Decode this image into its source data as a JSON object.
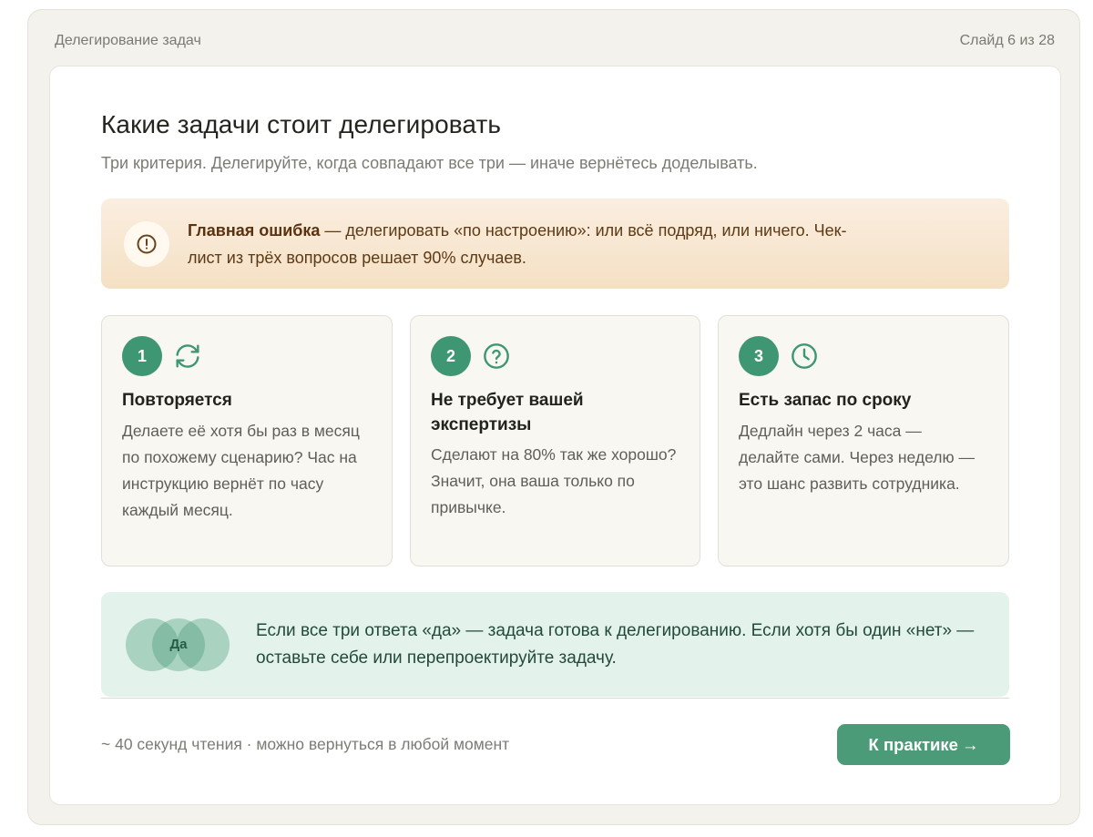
{
  "header": {
    "section_title": "Делегирование задач",
    "slide_counter": "Слайд 6 из 28"
  },
  "main": {
    "title": "Какие задачи стоит делегировать",
    "subtitle": "Три критерия. Делегируйте, когда совпадают все три — иначе вернётесь доделывать."
  },
  "alert": {
    "icon": "alert-circle-icon",
    "bold": "Главная ошибка",
    "line1": " — делегировать «по настроению»: или всё подряд, или ничего. Чек-",
    "line2": "лист из трёх вопросов решает 90% случаев."
  },
  "criteria": [
    {
      "number": "1",
      "icon": "refresh-icon",
      "title": "Повторяется",
      "description": "Делаете её хотя бы раз в месяц по похожему сценарию? Час на инструкцию вернёт по часу каждый месяц."
    },
    {
      "number": "2",
      "icon": "question-circle-icon",
      "title": "Не требует вашей экспертизы",
      "description": "Сделают на 80% так же хорошо? Значит, она ваша только по привычке."
    },
    {
      "number": "3",
      "icon": "clock-icon",
      "title": "Есть запас по сроку",
      "description": "Дедлайн через 2 часа — делайте сами. Через неделю — это шанс развить сотрудника."
    }
  ],
  "summary": {
    "venn_label": "Да",
    "text": "Если все три ответа «да» — задача готова к делегированию. Если хотя бы один «нет» — оставьте себе или перепроектируйте задачу."
  },
  "footer": {
    "note": "~ 40 секунд чтения · можно вернуться в любой момент",
    "cta_label": "К практике",
    "cta_arrow": "→"
  },
  "colors": {
    "accent": "#3f9673",
    "button": "#4b9a78",
    "alert_bg": "#f4e0c4",
    "summary_bg": "#e3f3ec"
  }
}
